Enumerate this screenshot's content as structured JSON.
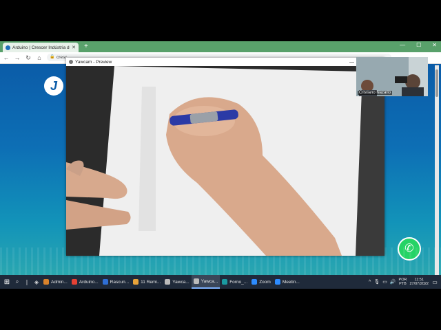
{
  "browser": {
    "tab_title": "Arduino | Crescer Indústria de A...",
    "new_tab": "+",
    "url": "cresc",
    "window_controls": [
      "—",
      "☐",
      "✕"
    ]
  },
  "yawcam": {
    "title": "Yawcam - Preview",
    "minimize": "—"
  },
  "participant": {
    "name": "Cristiano Nazario"
  },
  "whatsapp": {
    "icon": "whatsapp-icon"
  },
  "taskbar": {
    "apps": [
      {
        "label": "Admin...",
        "color": "#d9822b",
        "icon": "folder-icon"
      },
      {
        "label": "Arduino...",
        "color": "#e44134",
        "icon": "chrome-icon"
      },
      {
        "label": "Rascun...",
        "color": "#2f6fd6",
        "icon": "outlook-icon"
      },
      {
        "label": "11 Remi...",
        "color": "#e8a33a",
        "icon": "reminder-icon"
      },
      {
        "label": "Yawca...",
        "color": "#bbbbbb",
        "icon": "webcam-icon"
      },
      {
        "label": "Yawca...",
        "color": "#bbbbbb",
        "icon": "webcam-icon",
        "active": true
      },
      {
        "label": "Forno_...",
        "color": "#1a9aa0",
        "icon": "arduino-icon"
      },
      {
        "label": "Zoom",
        "color": "#2d8cff",
        "icon": "zoom-icon"
      },
      {
        "label": "Meetin...",
        "color": "#2d8cff",
        "icon": "zoom-icon"
      }
    ],
    "lang_top": "POR",
    "lang_bottom": "PTB",
    "time": "11:51",
    "date": "27/07/2022"
  }
}
